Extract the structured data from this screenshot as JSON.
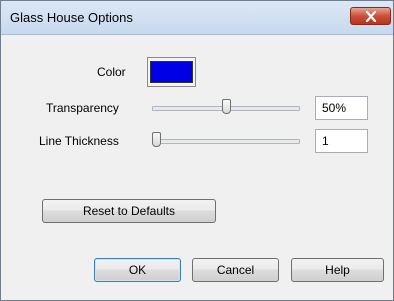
{
  "window": {
    "title": "Glass House Options",
    "close_icon": "close-icon"
  },
  "color": {
    "label": "Color",
    "value": "#0000e6"
  },
  "transparency": {
    "label": "Transparency",
    "value": "50%",
    "level_fraction": 0.5
  },
  "line_thickness": {
    "label": "Line Thickness",
    "value": "1",
    "level_fraction": 0.0
  },
  "buttons": {
    "reset": "Reset to Defaults",
    "ok": "OK",
    "cancel": "Cancel",
    "help": "Help"
  }
}
